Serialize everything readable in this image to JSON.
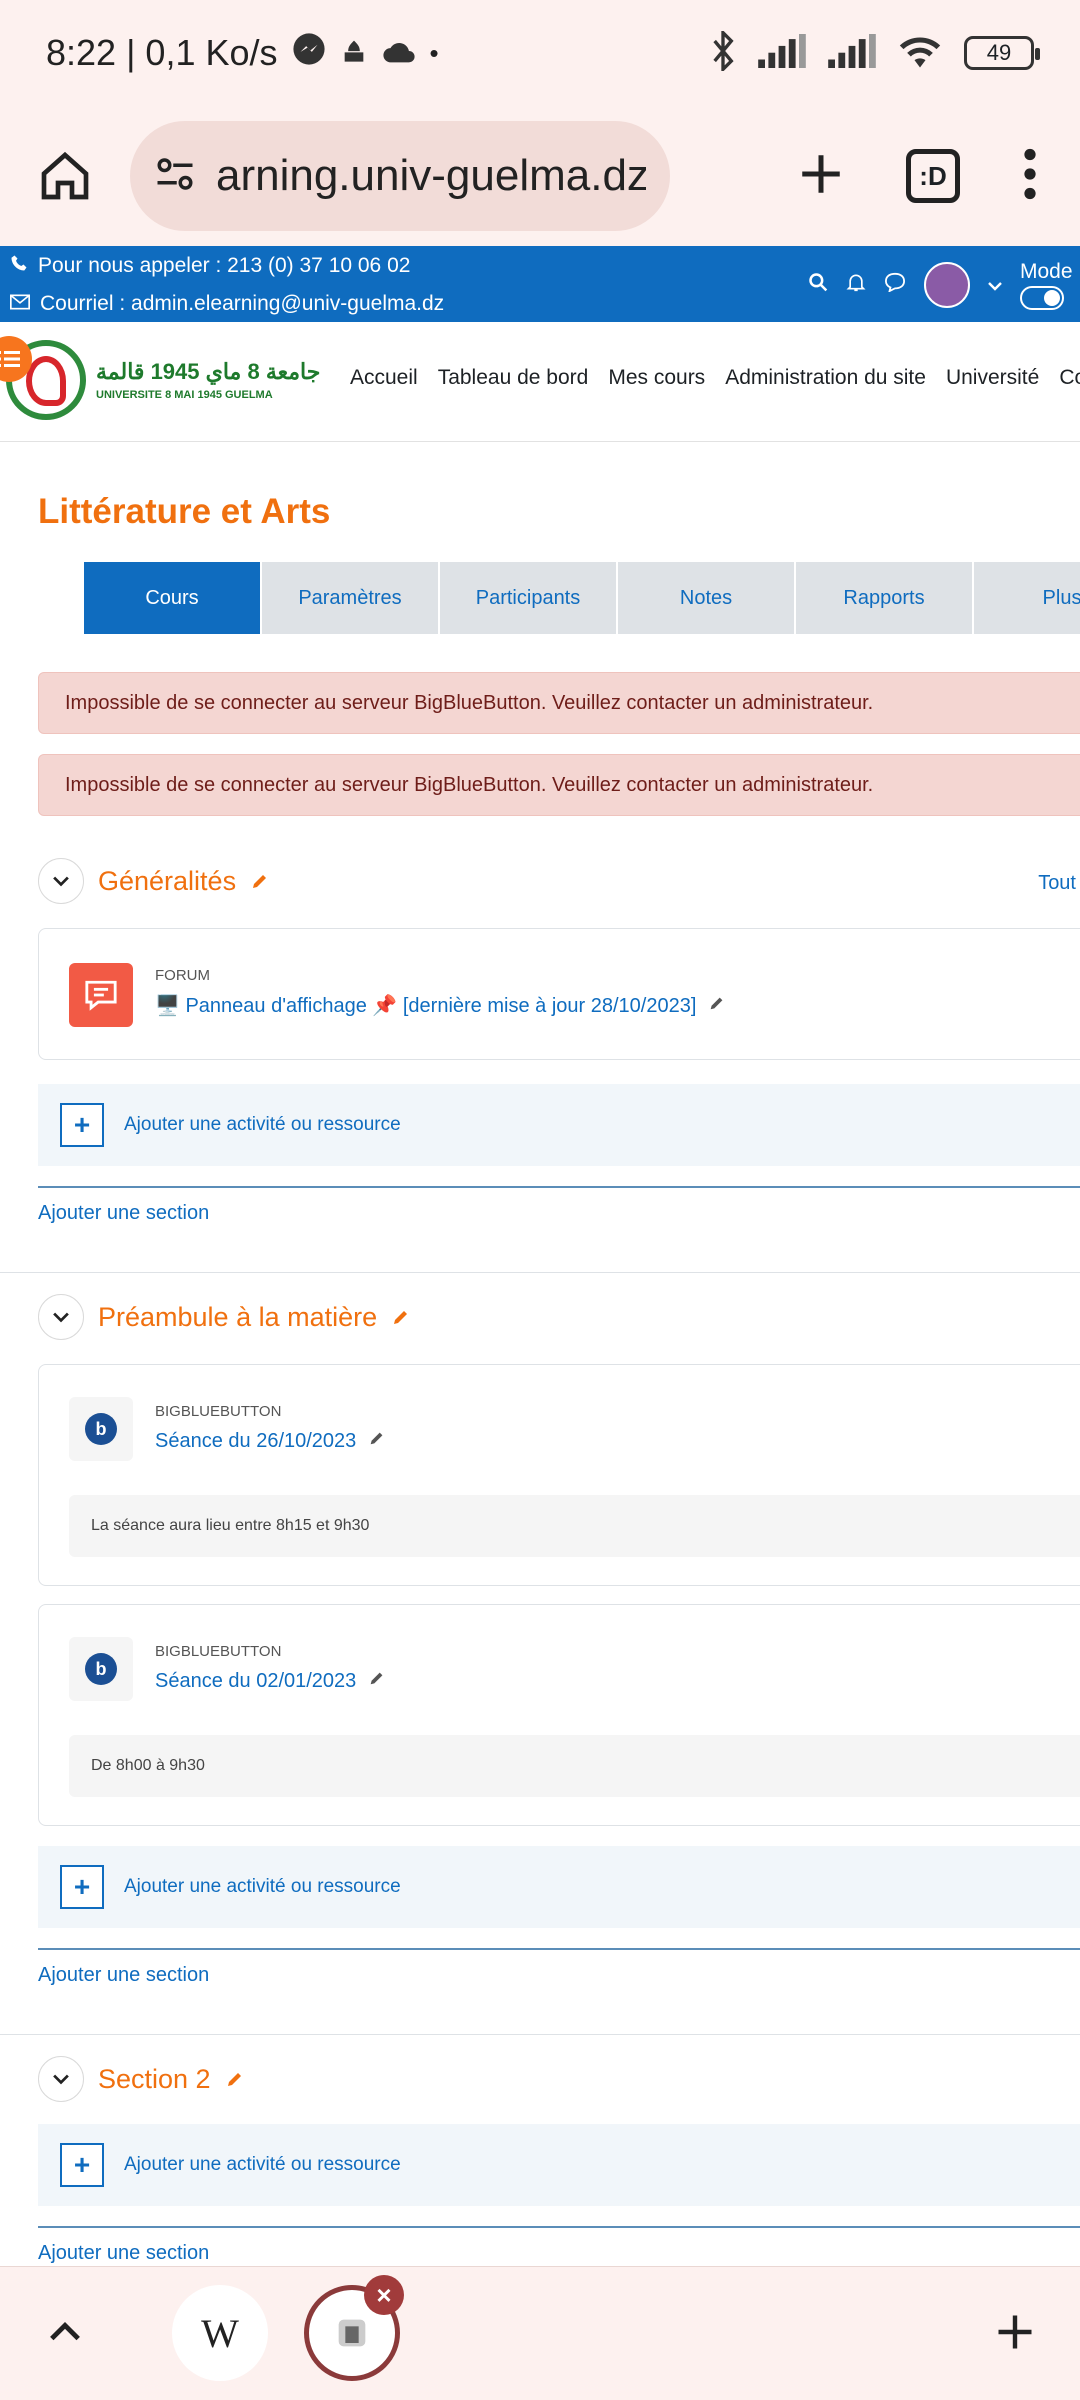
{
  "status_bar": {
    "time_speed": "8:22 | 0,1 Ko/s",
    "battery": "49"
  },
  "browser": {
    "url": "arning.univ-guelma.dz",
    "tab_count": ":D"
  },
  "info_bar": {
    "phone": "Pour nous appeler : 213 (0) 37 10 06 02",
    "email": "Courriel : admin.elearning@univ-guelma.dz",
    "mode_label": "Mode"
  },
  "logo": {
    "arabic": "جامعة 8 ماي 1945 قالمة",
    "french": "UNIVERSITE 8 MAI 1945 GUELMA"
  },
  "nav": {
    "items": [
      "Accueil",
      "Tableau de bord",
      "Mes cours",
      "Administration du site",
      "Université",
      "Co"
    ]
  },
  "course": {
    "title": "Littérature et Arts",
    "tabs": [
      "Cours",
      "Paramètres",
      "Participants",
      "Notes",
      "Rapports",
      "Plus"
    ]
  },
  "alerts": [
    "Impossible de se connecter au serveur BigBlueButton. Veuillez contacter un administrateur.",
    "Impossible de se connecter au serveur BigBlueButton. Veuillez contacter un administrateur."
  ],
  "sections": [
    {
      "title": "Généralités",
      "expand_all": "Tout",
      "activities": [
        {
          "type": "FORUM",
          "name": "🖥️ Panneau d'affichage 📌 [dernière mise à jour 28/10/2023]"
        }
      ]
    },
    {
      "title": "Préambule à la matière",
      "activities": [
        {
          "type": "BIGBLUEBUTTON",
          "name": "Séance du 26/10/2023",
          "description": "La séance aura lieu entre 8h15 et 9h30"
        },
        {
          "type": "BIGBLUEBUTTON",
          "name": "Séance du 02/01/2023",
          "description": "De 8h00 à 9h30"
        }
      ]
    },
    {
      "title": "Section 2",
      "activities": []
    }
  ],
  "actions": {
    "add_activity": "Ajouter une activité ou ressource",
    "add_section": "Ajouter une section"
  },
  "bottom_bar": {
    "wiki_label": "W"
  },
  "colors": {
    "moodle_blue": "#0f6cbf",
    "accent_orange": "#f0700f",
    "browser_bg": "#fdf1ef"
  }
}
